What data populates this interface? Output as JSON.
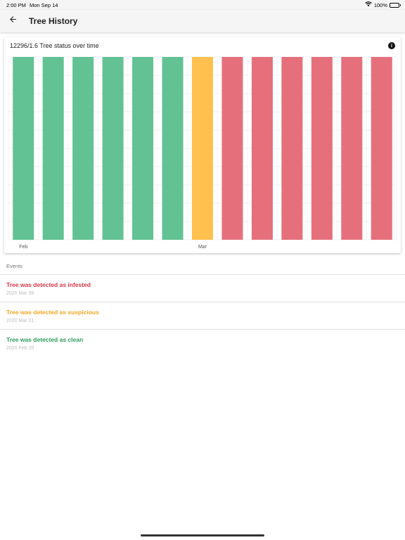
{
  "status_bar": {
    "time": "2:00 PM",
    "date": "Mon Sep 14",
    "battery": "100%"
  },
  "app_bar": {
    "title": "Tree History",
    "back_icon": "arrow-back-icon"
  },
  "chart": {
    "info_icon": "info-icon"
  },
  "chart_data": {
    "type": "bar",
    "title": "12296/1.6 Tree status over time",
    "x_tick_labels": [
      "Feb",
      "Mar"
    ],
    "bars": [
      {
        "status": "clean",
        "value": 1
      },
      {
        "status": "clean",
        "value": 1
      },
      {
        "status": "clean",
        "value": 1
      },
      {
        "status": "clean",
        "value": 1
      },
      {
        "status": "clean",
        "value": 1
      },
      {
        "status": "clean",
        "value": 1
      },
      {
        "status": "suspicious",
        "value": 1
      },
      {
        "status": "infested",
        "value": 1
      },
      {
        "status": "infested",
        "value": 1
      },
      {
        "status": "infested",
        "value": 1
      },
      {
        "status": "infested",
        "value": 1
      },
      {
        "status": "infested",
        "value": 1
      },
      {
        "status": "infested",
        "value": 1
      }
    ],
    "tick_bar_index": {
      "Feb": 0,
      "Mar": 6
    },
    "ylim": [
      0,
      1
    ],
    "grid": true,
    "legend": "none",
    "colors": {
      "clean": "#62c293",
      "suspicious": "#ffc04d",
      "infested": "#e5707c"
    }
  },
  "events": {
    "header": "Events",
    "items": [
      {
        "title": "Tree was detected as infested",
        "date": "2020 Mar 08",
        "color": "#d93645"
      },
      {
        "title": "Tree was detected as suspicious",
        "date": "2020 Mar 01",
        "color": "#f5a623"
      },
      {
        "title": "Tree was detected as clean",
        "date": "2020 Feb 20",
        "color": "#2c9c5b"
      }
    ]
  }
}
